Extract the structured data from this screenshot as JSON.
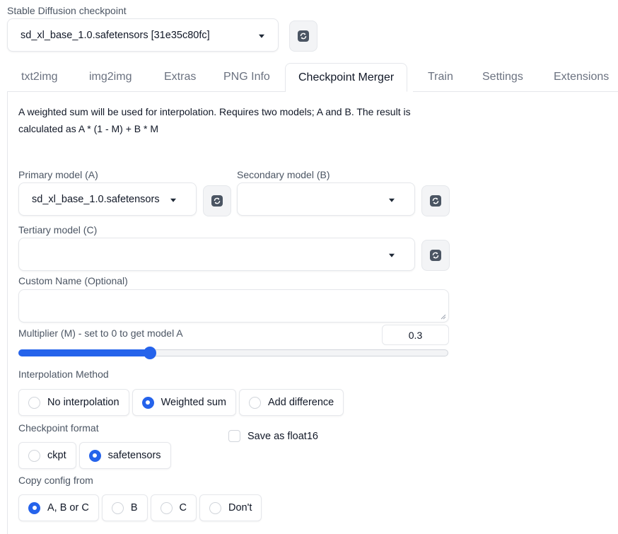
{
  "checkpoint": {
    "label": "Stable Diffusion checkpoint",
    "value": "sd_xl_base_1.0.safetensors [31e35c80fc]"
  },
  "tabs": [
    {
      "label": "txt2img",
      "active": false
    },
    {
      "label": "img2img",
      "active": false
    },
    {
      "label": "Extras",
      "active": false
    },
    {
      "label": "PNG Info",
      "active": false
    },
    {
      "label": "Checkpoint Merger",
      "active": true
    },
    {
      "label": "Train",
      "active": false
    },
    {
      "label": "Settings",
      "active": false
    },
    {
      "label": "Extensions",
      "active": false
    }
  ],
  "merger": {
    "description_line1": "A weighted sum will be used for interpolation. Requires two models; A and B. The result is",
    "description_line2": "calculated as A * (1 - M) + B * M",
    "primary": {
      "label": "Primary model (A)",
      "value": "sd_xl_base_1.0.safetensors"
    },
    "secondary": {
      "label": "Secondary model (B)",
      "value": ""
    },
    "tertiary": {
      "label": "Tertiary model (C)",
      "value": ""
    },
    "custom_name": {
      "label": "Custom Name (Optional)",
      "value": ""
    },
    "multiplier": {
      "label": "Multiplier (M) - set to 0 to get model A",
      "value": "0.3",
      "fraction": 0.3
    },
    "interpolation": {
      "label": "Interpolation Method",
      "options": [
        "No interpolation",
        "Weighted sum",
        "Add difference"
      ],
      "selected": "Weighted sum"
    },
    "format": {
      "label": "Checkpoint format",
      "options": [
        "ckpt",
        "safetensors"
      ],
      "selected": "safetensors"
    },
    "float16": {
      "label": "Save as float16",
      "checked": false
    },
    "copy_config": {
      "label": "Copy config from",
      "options": [
        "A, B or C",
        "B",
        "C",
        "Don't"
      ],
      "selected": "A, B or C"
    }
  },
  "colors": {
    "accent": "#2563eb",
    "border": "#e5e7eb",
    "button_bg": "#f3f4f6"
  },
  "icons": {
    "refresh": "refresh-icon",
    "caret": "chevron-down-icon"
  }
}
